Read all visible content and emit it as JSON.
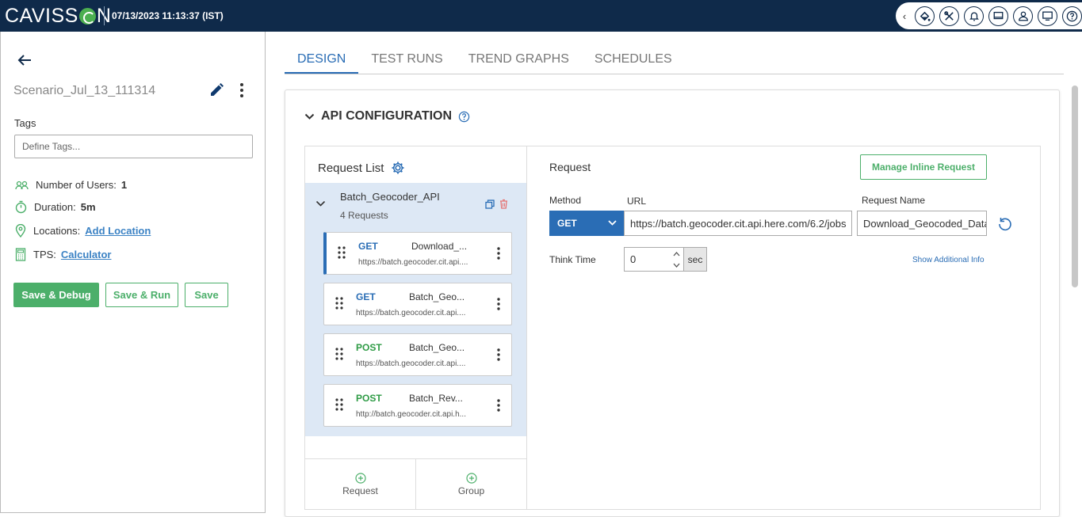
{
  "header": {
    "logo_text_left": "CAVISS",
    "logo_text_right": "N",
    "datetime": "07/13/2023 11:13:37 (IST)",
    "icons": [
      "chevron-left-icon",
      "paint-bucket-icon",
      "tools-icon",
      "bell-icon",
      "monitor-icon",
      "user-icon",
      "display-icon",
      "help-icon"
    ]
  },
  "sidebar": {
    "scenario_name": "Scenario_Jul_13_111314",
    "tags_label": "Tags",
    "tags_placeholder": "Define Tags...",
    "users_label": "Number of Users:",
    "users_value": "1",
    "duration_label": "Duration:",
    "duration_value": "5m",
    "locations_label": "Locations:",
    "locations_link": "Add Location",
    "tps_label": "TPS:",
    "tps_link": "Calculator",
    "buttons": {
      "save_debug": "Save & Debug",
      "save_run": "Save & Run",
      "save": "Save"
    }
  },
  "tabs": [
    {
      "label": "DESIGN",
      "active": true
    },
    {
      "label": "TEST RUNS",
      "active": false
    },
    {
      "label": "TREND GRAPHS",
      "active": false
    },
    {
      "label": "SCHEDULES",
      "active": false
    }
  ],
  "api_config": {
    "title": "API CONFIGURATION",
    "request_list": {
      "title": "Request List",
      "group": {
        "name": "Batch_Geocoder_API",
        "count": "4 Requests"
      },
      "items": [
        {
          "method": "GET",
          "name": "Download_...",
          "url": "https://batch.geocoder.cit.api...."
        },
        {
          "method": "GET",
          "name": "Batch_Geo...",
          "url": "https://batch.geocoder.cit.api...."
        },
        {
          "method": "POST",
          "name": "Batch_Geo...",
          "url": "https://batch.geocoder.cit.api...."
        },
        {
          "method": "POST",
          "name": "Batch_Rev...",
          "url": "http://batch.geocoder.cit.api.h..."
        }
      ],
      "add_request": "Request",
      "add_group": "Group"
    },
    "request": {
      "title": "Request",
      "manage_btn": "Manage Inline Request",
      "method_label": "Method",
      "method_value": "GET",
      "url_label": "URL",
      "url_value": "https://batch.geocoder.cit.api.here.com/6.2/jobs",
      "name_label": "Request Name",
      "name_value": "Download_Geocoded_Data",
      "think_label": "Think Time",
      "think_value": "0",
      "think_unit": "sec",
      "show_info": "Show Additional Info"
    }
  },
  "colors": {
    "topbar": "#0f2a4a",
    "accent_blue": "#2a6db5",
    "accent_green": "#4caf6a",
    "post_green": "#2e9b45",
    "group_bg": "#dde8f5"
  }
}
